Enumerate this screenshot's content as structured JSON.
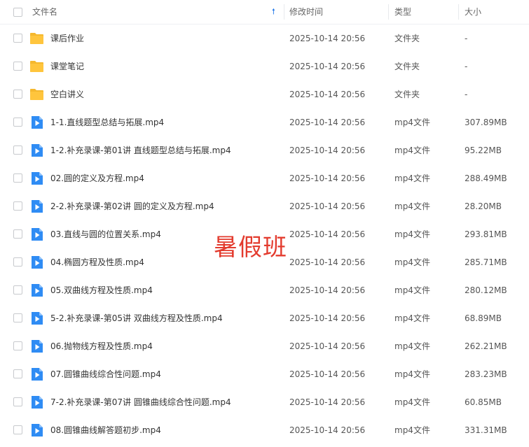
{
  "header": {
    "name_label": "文件名",
    "time_label": "修改时间",
    "type_label": "类型",
    "size_label": "大小",
    "sort_icon": "arrow-up-icon",
    "accent_color": "#1a73e8"
  },
  "rows": [
    {
      "kind": "folder",
      "name": "课后作业",
      "time": "2025-10-14 20:56",
      "type": "文件夹",
      "size": "-"
    },
    {
      "kind": "folder",
      "name": "课堂笔记",
      "time": "2025-10-14 20:56",
      "type": "文件夹",
      "size": "-"
    },
    {
      "kind": "folder",
      "name": "空白讲义",
      "time": "2025-10-14 20:56",
      "type": "文件夹",
      "size": "-"
    },
    {
      "kind": "video",
      "name": "1-1.直线题型总结与拓展.mp4",
      "time": "2025-10-14 20:56",
      "type": "mp4文件",
      "size": "307.89MB"
    },
    {
      "kind": "video",
      "name": "1-2.补充录课-第01讲 直线题型总结与拓展.mp4",
      "time": "2025-10-14 20:56",
      "type": "mp4文件",
      "size": "95.22MB"
    },
    {
      "kind": "video",
      "name": "02.圆的定义及方程.mp4",
      "time": "2025-10-14 20:56",
      "type": "mp4文件",
      "size": "288.49MB"
    },
    {
      "kind": "video",
      "name": "2-2.补充录课-第02讲 圆的定义及方程.mp4",
      "time": "2025-10-14 20:56",
      "type": "mp4文件",
      "size": "28.20MB"
    },
    {
      "kind": "video",
      "name": "03.直线与圆的位置关系.mp4",
      "time": "2025-10-14 20:56",
      "type": "mp4文件",
      "size": "293.81MB"
    },
    {
      "kind": "video",
      "name": "04.椭圆方程及性质.mp4",
      "time": "2025-10-14 20:56",
      "type": "mp4文件",
      "size": "285.71MB"
    },
    {
      "kind": "video",
      "name": "05.双曲线方程及性质.mp4",
      "time": "2025-10-14 20:56",
      "type": "mp4文件",
      "size": "280.12MB"
    },
    {
      "kind": "video",
      "name": "5-2.补充录课-第05讲 双曲线方程及性质.mp4",
      "time": "2025-10-14 20:56",
      "type": "mp4文件",
      "size": "68.89MB"
    },
    {
      "kind": "video",
      "name": "06.抛物线方程及性质.mp4",
      "time": "2025-10-14 20:56",
      "type": "mp4文件",
      "size": "262.21MB"
    },
    {
      "kind": "video",
      "name": "07.圆锥曲线综合性问题.mp4",
      "time": "2025-10-14 20:56",
      "type": "mp4文件",
      "size": "283.23MB"
    },
    {
      "kind": "video",
      "name": "7-2.补充录课-第07讲 圆锥曲线综合性问题.mp4",
      "time": "2025-10-14 20:56",
      "type": "mp4文件",
      "size": "60.85MB"
    },
    {
      "kind": "video",
      "name": "08.圆锥曲线解答题初步.mp4",
      "time": "2025-10-14 20:56",
      "type": "mp4文件",
      "size": "331.31MB"
    }
  ],
  "watermark": {
    "text": "暑假班",
    "color": "#e33b2e"
  },
  "colors": {
    "folder": "#ffc53d",
    "video": "#2f8cf4"
  }
}
